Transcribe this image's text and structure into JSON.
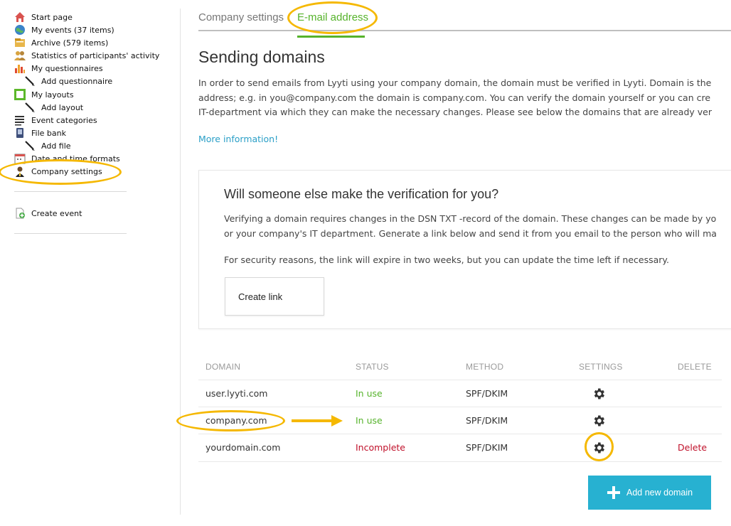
{
  "sidebar": {
    "items": [
      {
        "label": "Start page",
        "icon": "house-icon"
      },
      {
        "label": "My events (37 items)",
        "icon": "globe-icon"
      },
      {
        "label": "Archive (579 items)",
        "icon": "archive-icon"
      },
      {
        "label": "Statistics of participants' activity",
        "icon": "people-icon"
      },
      {
        "label": "My questionnaires",
        "icon": "bar-chart-icon"
      },
      {
        "label": "Add questionnaire",
        "icon": "pen-icon"
      },
      {
        "label": "My layouts",
        "icon": "layout-icon"
      },
      {
        "label": "Add layout",
        "icon": "pen-icon"
      },
      {
        "label": "Event categories",
        "icon": "list-icon"
      },
      {
        "label": "File bank",
        "icon": "device-icon"
      },
      {
        "label": "Add file",
        "icon": "pen-icon"
      },
      {
        "label": "Date and time formats",
        "icon": "calendar-icon"
      },
      {
        "label": "Company settings",
        "icon": "person-icon"
      }
    ],
    "create_event": {
      "label": "Create event",
      "icon": "add-document-icon"
    }
  },
  "tabs": [
    {
      "label": "Company settings",
      "active": false
    },
    {
      "label": "E-mail address",
      "active": true
    }
  ],
  "page": {
    "title": "Sending domains",
    "intro_lines": [
      "In order to send emails from Lyyti using your company domain, the domain must be verified in Lyyti. Domain is the",
      "address; e.g. in you@company.com the domain is company.com. You can verify the domain yourself or you can cre",
      "IT-department via which they can make the necessary changes. Please see below the domains that are already ver"
    ],
    "more_info": "More information!"
  },
  "verify_card": {
    "title": "Will someone else make the verification for you?",
    "lines": [
      "Verifying a domain requires changes in the DSN TXT -record of the domain. These changes can be made by yo",
      "or your company's IT department. Generate a link below and send it from you email to the person who will ma"
    ],
    "security_note": "For security reasons, the link will expire in two weeks, but you can update the time left if necessary.",
    "button_label": "Create link"
  },
  "table": {
    "headers": {
      "domain": "DOMAIN",
      "status": "STATUS",
      "method": "METHOD",
      "settings": "SETTINGS",
      "delete": "DELETE"
    },
    "rows": [
      {
        "domain": "user.lyyti.com",
        "status": "In use",
        "method": "SPF/DKIM",
        "delete": ""
      },
      {
        "domain": "company.com",
        "status": "In use",
        "method": "SPF/DKIM",
        "delete": ""
      },
      {
        "domain": "yourdomain.com",
        "status": "Incomplete",
        "method": "SPF/DKIM",
        "delete": "Delete"
      }
    ]
  },
  "add_button_label": "Add new domain",
  "colors": {
    "accent_green": "#56b32b",
    "status_in_use": "#56b32b",
    "status_incomplete": "#c0102a",
    "link_blue": "#2a9fc7",
    "primary_button": "#27b1d1",
    "annotation": "#f5b800"
  }
}
